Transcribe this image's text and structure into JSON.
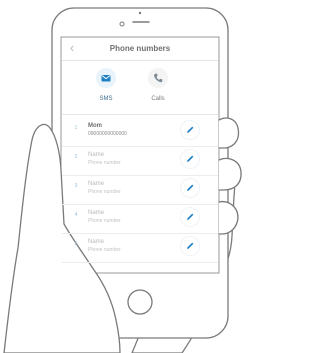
{
  "header": {
    "title": "Phone numbers",
    "back_icon": "chevron-left-icon"
  },
  "tabs": [
    {
      "label": "SMS",
      "icon": "sms-icon",
      "active": true
    },
    {
      "label": "Calls",
      "icon": "phone-icon",
      "active": false
    }
  ],
  "contacts": [
    {
      "index": "1",
      "name": "Mom",
      "phone": "09000000000000",
      "filled": true
    },
    {
      "index": "2",
      "name": "Name",
      "phone": "Phone number",
      "filled": false
    },
    {
      "index": "3",
      "name": "Name",
      "phone": "Phone number",
      "filled": false
    },
    {
      "index": "4",
      "name": "Name",
      "phone": "Phone number",
      "filled": false
    },
    {
      "index": "5",
      "name": "Name",
      "phone": "Phone number",
      "filled": false
    }
  ],
  "colors": {
    "accent": "#1f7fc3",
    "text": "#6f6f6f",
    "placeholder": "#b8b8b8"
  }
}
